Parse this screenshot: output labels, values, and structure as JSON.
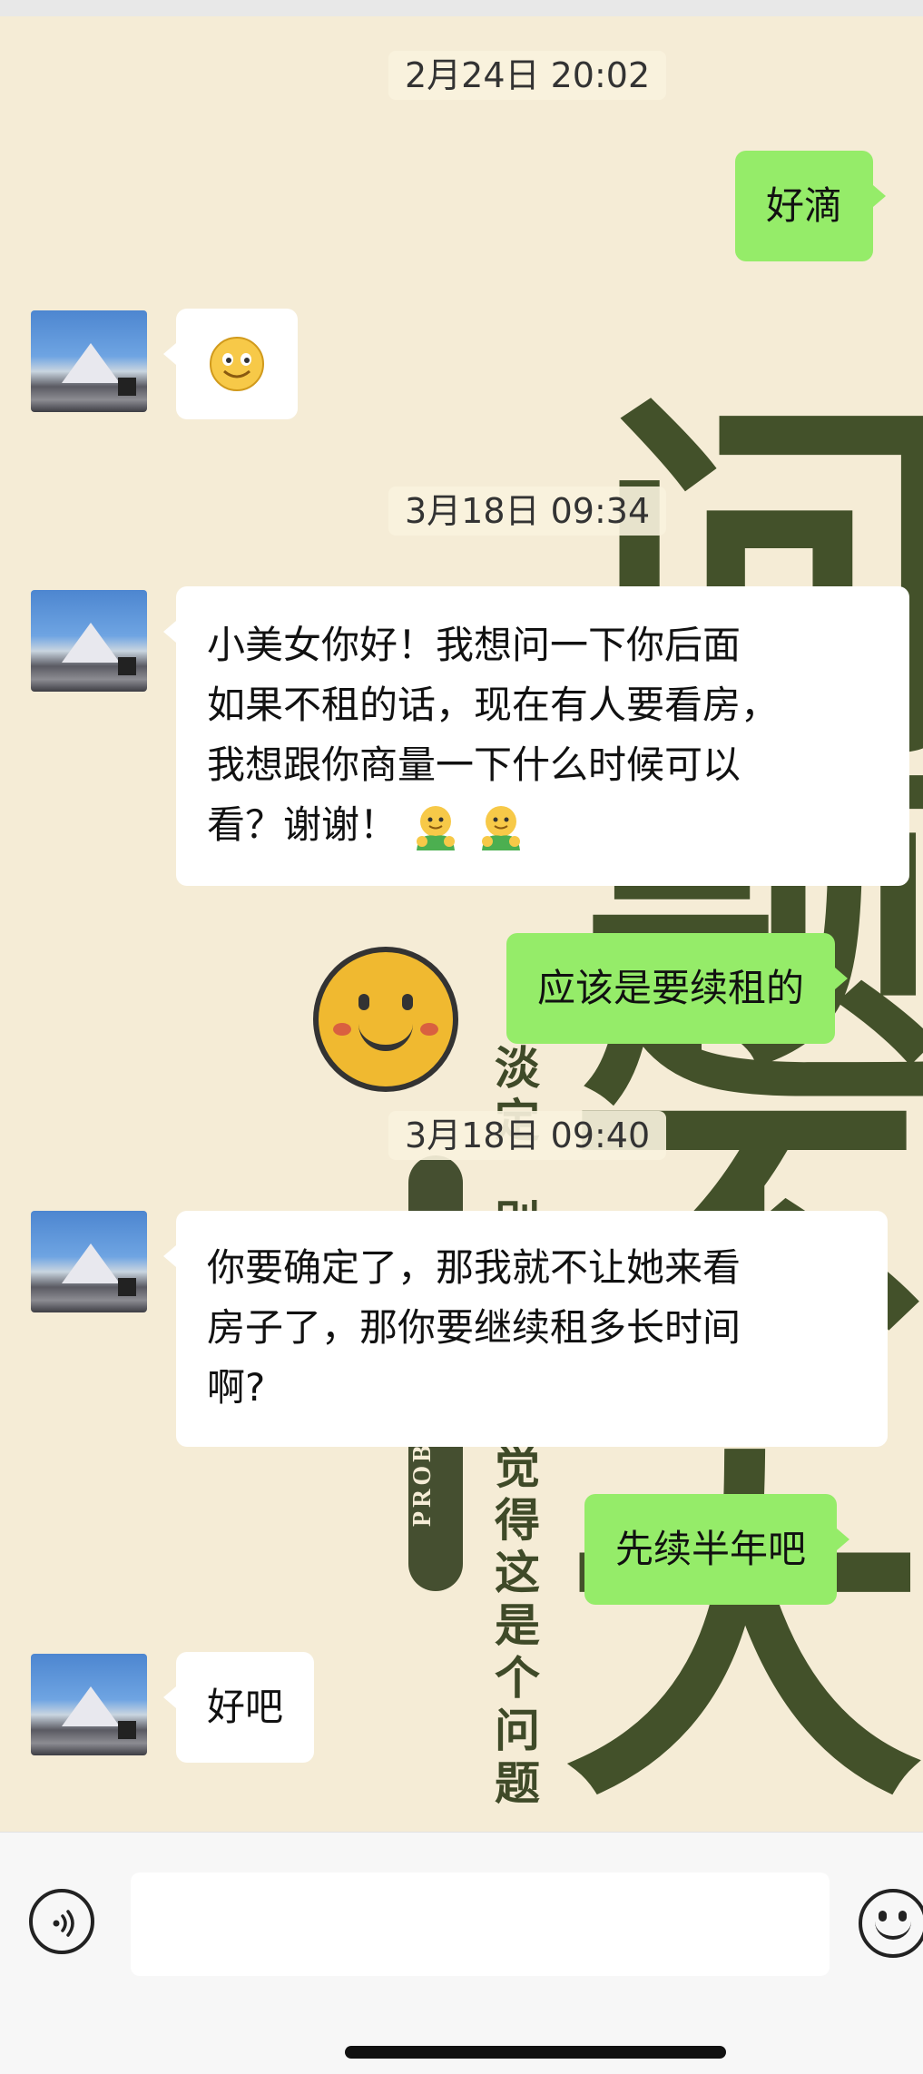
{
  "wallpaper": {
    "big_chars": [
      "问",
      "题",
      "不",
      "大"
    ],
    "vertical_text_1": "淡定",
    "vertical_text_2": "别",
    "vertical_text_3": "觉得这是个问题",
    "pill_text": "PROBLEM-SOLVING"
  },
  "messages": [
    {
      "type": "timestamp",
      "text": "2月24日 20:02"
    },
    {
      "type": "outgoing",
      "text": "好滴"
    },
    {
      "type": "incoming",
      "text": "",
      "emoji": "smile-emoji"
    },
    {
      "type": "timestamp",
      "text": "3月18日 09:34"
    },
    {
      "type": "incoming",
      "lines": [
        "小美女你好！我想问一下你后面",
        "如果不租的话，现在有人要看房，",
        "我想跟你商量一下什么时候可以",
        "看？谢谢！"
      ],
      "emoji": "hug-emoji"
    },
    {
      "type": "outgoing",
      "text": "应该是要续租的"
    },
    {
      "type": "timestamp",
      "text": "3月18日 09:40"
    },
    {
      "type": "incoming",
      "lines": [
        "你要确定了，那我就不让她来看",
        "房子了，那你要继续租多长时间",
        "啊?"
      ]
    },
    {
      "type": "outgoing",
      "text": "先续半年吧"
    },
    {
      "type": "incoming",
      "text": "好吧"
    }
  ],
  "input_bar": {
    "voice_icon": "voice-icon",
    "input_value": "",
    "emoji_icon": "emoji-icon"
  },
  "colors": {
    "outgoing_bubble": "#95ec69",
    "incoming_bubble": "#ffffff",
    "wallpaper": "#f5ecd6",
    "wallpaper_ink": "#43512a"
  }
}
